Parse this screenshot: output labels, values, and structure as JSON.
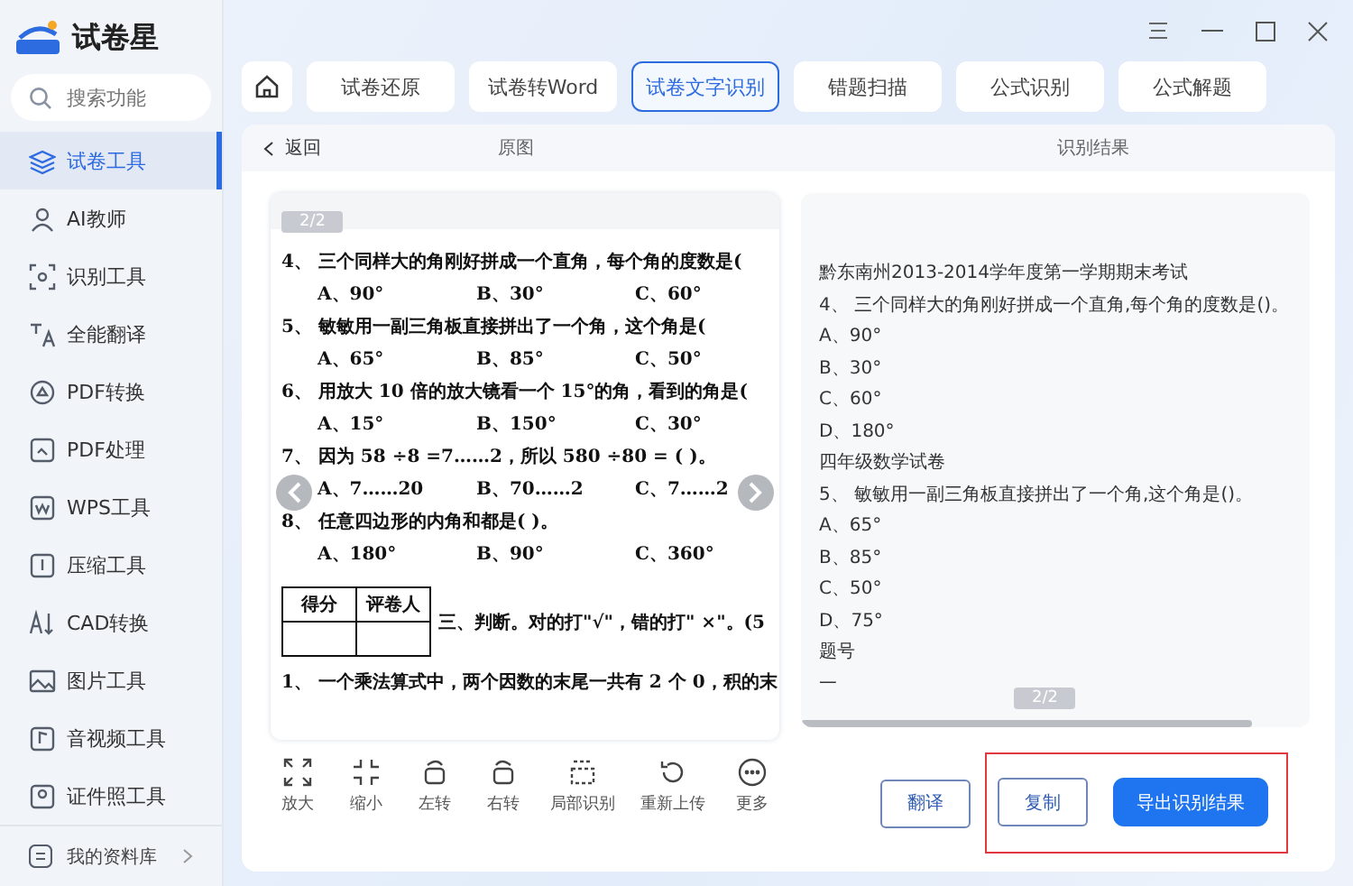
{
  "app": {
    "title": "试卷星"
  },
  "sidebar": {
    "search": {
      "placeholder": "搜索功能"
    },
    "items": [
      {
        "label": "试卷工具",
        "kind": "layers",
        "selected": true
      },
      {
        "label": "AI教师",
        "kind": "people",
        "selected": false
      },
      {
        "label": "识别工具",
        "kind": "scan",
        "selected": false
      },
      {
        "label": "全能翻译",
        "kind": "translate",
        "selected": false
      },
      {
        "label": "PDF转换",
        "kind": "convert",
        "selected": false
      },
      {
        "label": "PDF处理",
        "kind": "file",
        "selected": false
      },
      {
        "label": "WPS工具",
        "kind": "wps",
        "selected": false
      },
      {
        "label": "压缩工具",
        "kind": "zip",
        "selected": false
      },
      {
        "label": "CAD转换",
        "kind": "cad",
        "selected": false
      },
      {
        "label": "图片工具",
        "kind": "image",
        "selected": false
      },
      {
        "label": "音视频工具",
        "kind": "media",
        "selected": false
      },
      {
        "label": "证件照工具",
        "kind": "portrait",
        "selected": false
      }
    ],
    "footer": {
      "label": "我的资料库"
    }
  },
  "tabs": [
    {
      "label": "试卷还原",
      "selected": false
    },
    {
      "label": "试卷转Word",
      "selected": false
    },
    {
      "label": "试卷文字识别",
      "selected": true
    },
    {
      "label": "错题扫描",
      "selected": false
    },
    {
      "label": "公式识别",
      "selected": false
    },
    {
      "label": "公式解题",
      "selected": false
    }
  ],
  "panel": {
    "back": "返回",
    "original_heading": "原图",
    "result_heading": "识别结果"
  },
  "original": {
    "page": "2/2",
    "lines": [
      {
        "kind": "question",
        "text": "4、  三个同样大的角刚好拼成一个直角，每个角的度数是("
      },
      {
        "kind": "options",
        "options": [
          "A、90°",
          "B、30°",
          "C、60°"
        ]
      },
      {
        "kind": "question",
        "text": "5、  敏敏用一副三角板直接拼出了一个角，这个角是("
      },
      {
        "kind": "options",
        "options": [
          "A、65°",
          "B、85°",
          "C、50°"
        ]
      },
      {
        "kind": "question",
        "text": "6、  用放大 10 倍的放大镜看一个 15°的角，看到的角是("
      },
      {
        "kind": "options",
        "options": [
          "A、15°",
          "B、150°",
          "C、30°"
        ]
      },
      {
        "kind": "question",
        "text": "7、  因为 58 ÷8 =7……2，所以 580 ÷80 = (        )。"
      },
      {
        "kind": "options",
        "options": [
          "A、7……20",
          "B、70……2",
          "C、7……2"
        ]
      },
      {
        "kind": "question",
        "text": "8、  任意四边形的内角和都是(        )。"
      },
      {
        "kind": "options",
        "options": [
          "A、180°",
          "B、90°",
          "C、360°"
        ]
      },
      {
        "kind": "score",
        "headers": [
          "得分",
          "评卷人"
        ],
        "text": "三、判断。对的打\"√\"，错的打\" ×\"。(5"
      },
      {
        "kind": "question",
        "text": "1、  一个乘法算式中，两个因数的末尾一共有 2 个 0，积的末"
      }
    ]
  },
  "result": {
    "page": "2/2",
    "lines": [
      "黔东南州2013-2014学年度第一学期期末考试",
      "4、 三个同样大的角刚好拼成一个直角,每个角的度数是()。",
      "A、90°",
      "B、30°",
      "C、60°",
      "D、180°",
      "四年级数学试卷",
      "5、 敏敏用一副三角板直接拼出了一个角,这个角是()。",
      "A、65°",
      "B、85°",
      "C、50°",
      "D、75°",
      "题号",
      "一"
    ]
  },
  "tools": [
    {
      "label": "放大",
      "kind": "expand"
    },
    {
      "label": "缩小",
      "kind": "shrink"
    },
    {
      "label": "左转",
      "kind": "rotl"
    },
    {
      "label": "右转",
      "kind": "rotr"
    },
    {
      "label": "局部识别",
      "kind": "region"
    },
    {
      "label": "重新上传",
      "kind": "reupload"
    },
    {
      "label": "更多",
      "kind": "more"
    }
  ],
  "actions": [
    {
      "label": "翻译",
      "kind": "outline",
      "highlighted": false
    },
    {
      "label": "复制",
      "kind": "outline",
      "highlighted": true
    },
    {
      "label": "导出识别结果",
      "kind": "primary",
      "highlighted": true
    }
  ]
}
